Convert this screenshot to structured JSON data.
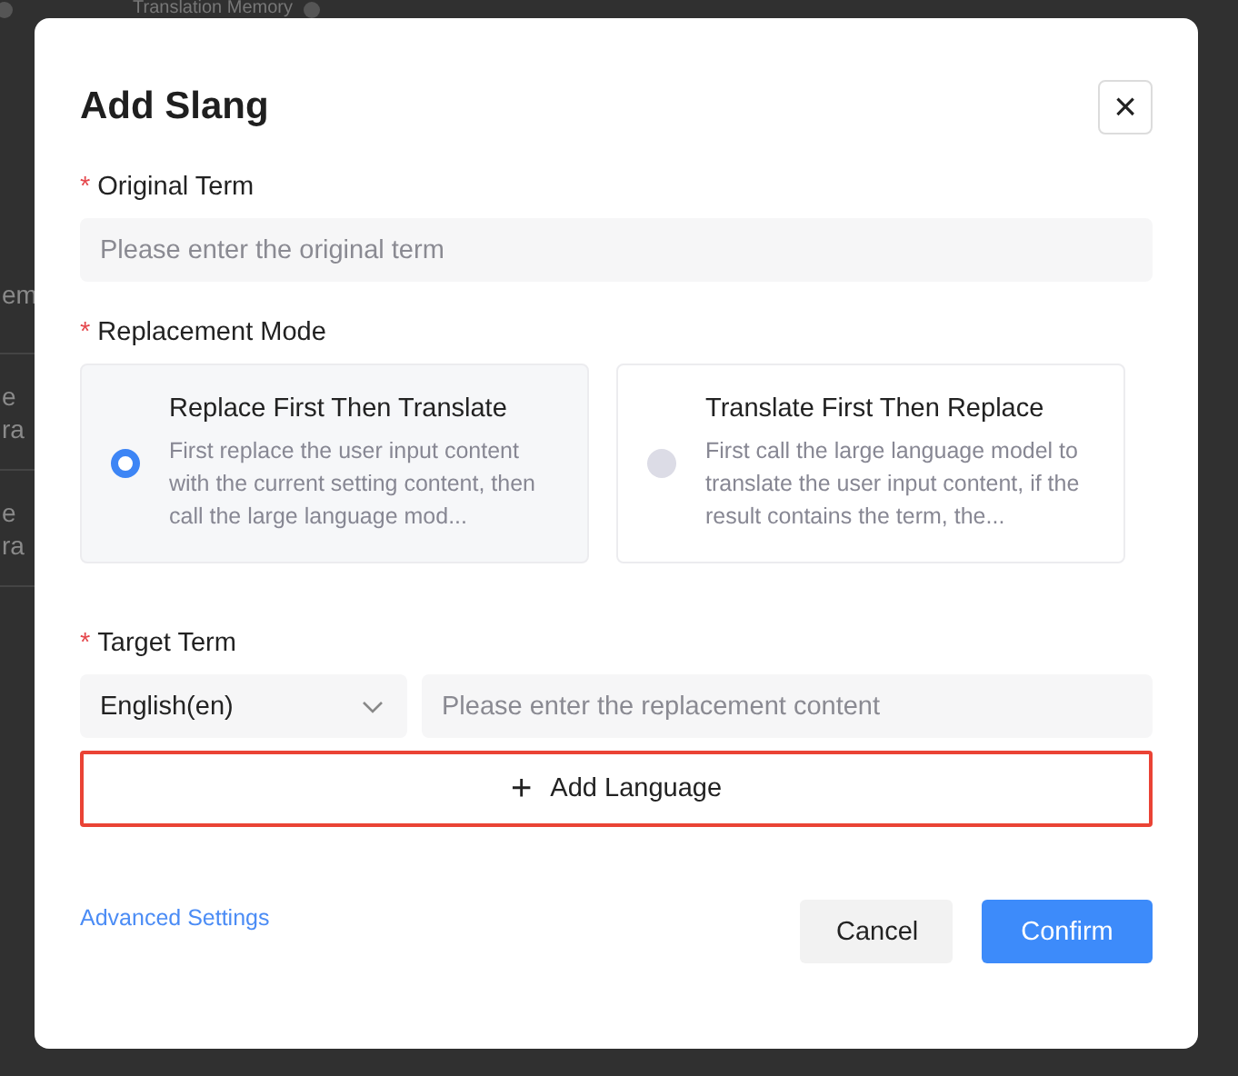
{
  "background": {
    "title": "Translation Memory",
    "fragments": [
      "em",
      "e",
      "ra",
      "e",
      "ra"
    ]
  },
  "dialog": {
    "title": "Add Slang",
    "close": "×",
    "original_term": {
      "label": "Original Term",
      "required_mark": "*",
      "placeholder": "Please enter the original term"
    },
    "replacement_mode": {
      "label": "Replacement Mode",
      "required_mark": "*",
      "options": [
        {
          "title": "Replace First Then Translate",
          "description": "First replace the user input content with the current setting content, then call the large language mod...",
          "selected": true
        },
        {
          "title": "Translate First Then Replace",
          "description": "First call the large language model to translate the user input content, if the result contains the term, the...",
          "selected": false
        }
      ]
    },
    "target_term": {
      "label": "Target Term",
      "required_mark": "*",
      "language": "English(en)",
      "placeholder": "Please enter the replacement content"
    },
    "add_language": {
      "icon": "+",
      "label": "Add Language"
    },
    "advanced_link": "Advanced Settings",
    "buttons": [
      {
        "label": "Cancel",
        "kind": "secondary"
      },
      {
        "label": "Confirm",
        "kind": "primary"
      }
    ]
  }
}
